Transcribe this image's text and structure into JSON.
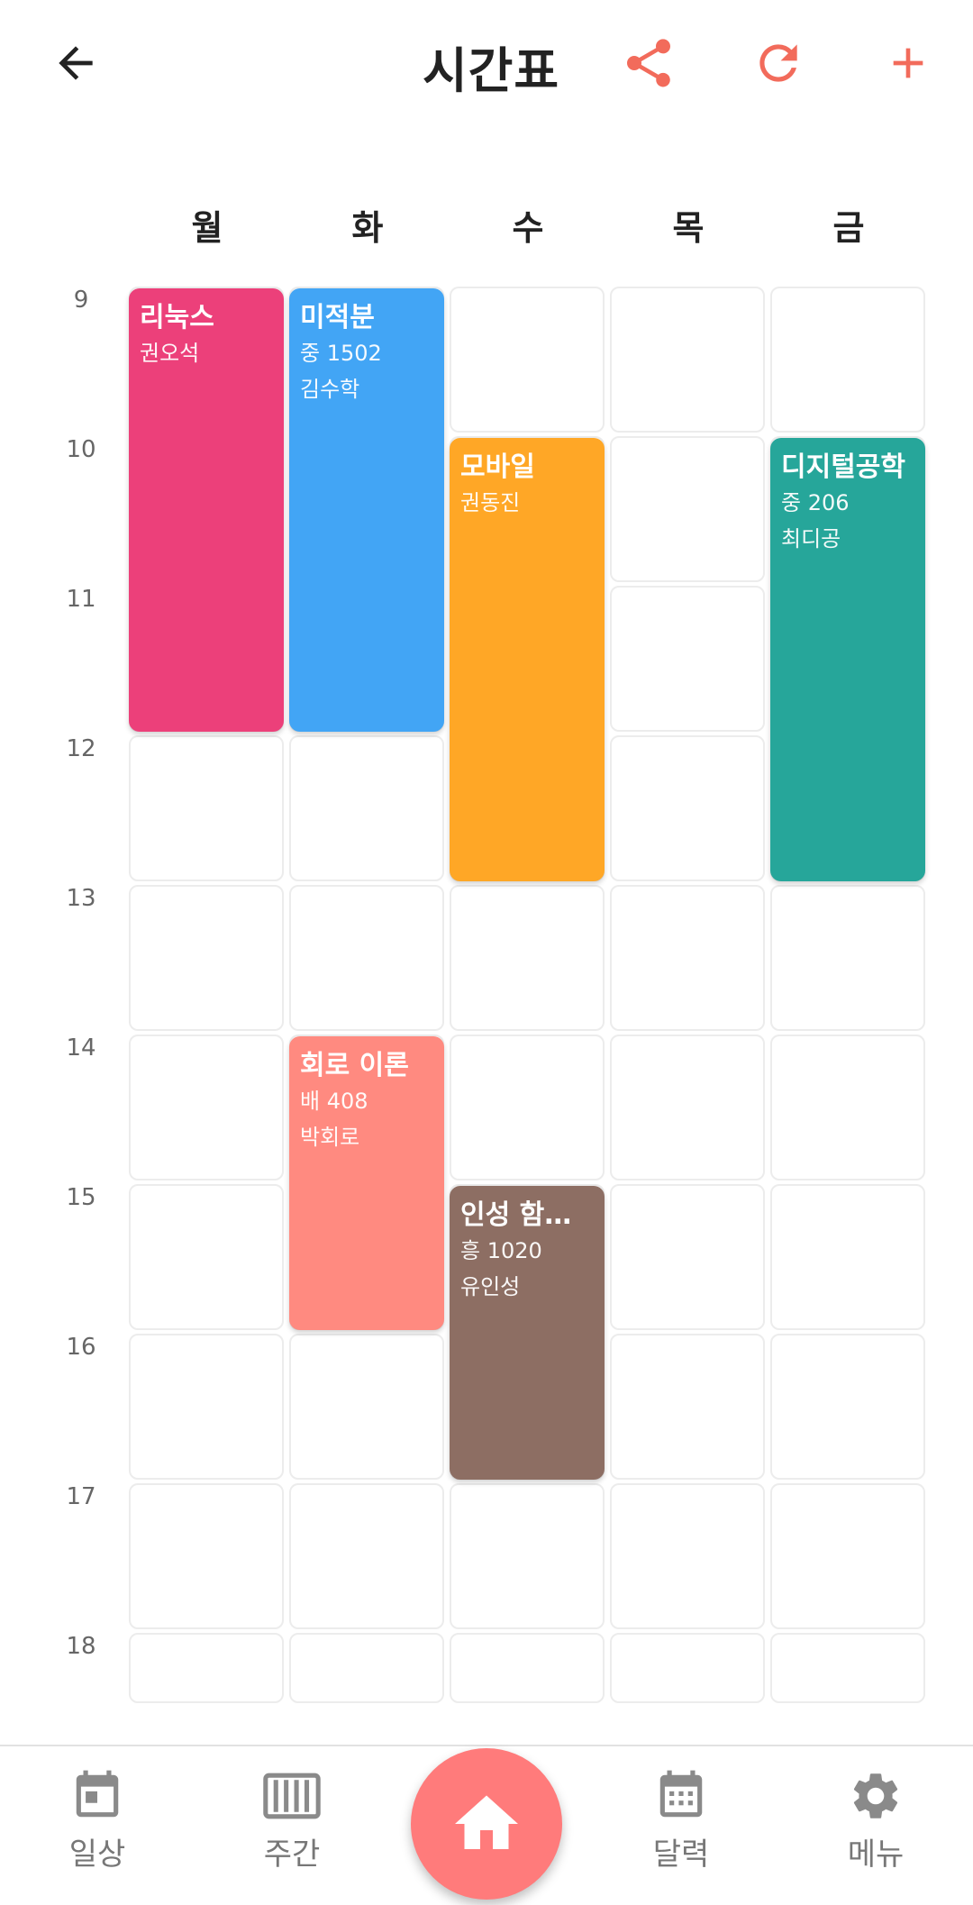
{
  "header": {
    "title": "시간표"
  },
  "colors": {
    "accent": "#F26B5B",
    "icon_gray": "#8A8A8A",
    "home": "#FF7B7B"
  },
  "days": [
    "월",
    "화",
    "수",
    "목",
    "금"
  ],
  "hours": [
    "9",
    "10",
    "11",
    "12",
    "13",
    "14",
    "15",
    "16",
    "17",
    "18"
  ],
  "events": [
    {
      "title": "리눅스",
      "room": "",
      "professor": "권오석",
      "day": "월",
      "start": "9",
      "end": "12",
      "color": "#EC407A"
    },
    {
      "title": "미적분",
      "room": "중 1502",
      "professor": "김수학",
      "day": "화",
      "start": "9",
      "end": "12",
      "color": "#42A5F5"
    },
    {
      "title": "모바일",
      "room": "",
      "professor": "권동진",
      "day": "수",
      "start": "10",
      "end": "13",
      "color": "#FFA726"
    },
    {
      "title": "디지털공학",
      "room": "중 206",
      "professor": "최디공",
      "day": "금",
      "start": "10",
      "end": "13",
      "color": "#26A69A"
    },
    {
      "title": "회로 이론",
      "room": "배 408",
      "professor": "박회로",
      "day": "화",
      "start": "14",
      "end": "16",
      "color": "#FF8A80"
    },
    {
      "title": "인성 함양…",
      "room": "흥 1020",
      "professor": "유인성",
      "day": "수",
      "start": "15",
      "end": "17",
      "color": "#8D6E63"
    }
  ],
  "nav": {
    "daily": "일상",
    "weekly": "주간",
    "calendar": "달력",
    "menu": "메뉴"
  }
}
